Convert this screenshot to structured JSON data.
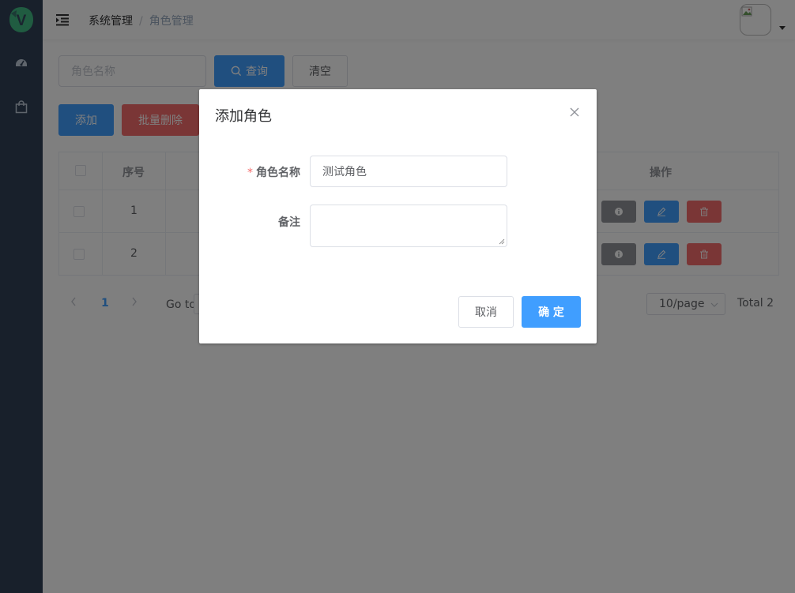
{
  "sidebar": {
    "logo_letter": "V",
    "items": [
      {
        "icon": "dashboard-icon"
      },
      {
        "icon": "shopping-bag-icon"
      }
    ]
  },
  "header": {
    "breadcrumb": [
      "系统管理",
      "角色管理"
    ],
    "separator": "/"
  },
  "search": {
    "placeholder": "角色名称",
    "query_label": "查询",
    "clear_label": "清空"
  },
  "toolbar": {
    "add_label": "添加",
    "batch_delete_label": "批量删除"
  },
  "table": {
    "columns": {
      "index": "序号",
      "actions": "操作"
    },
    "rows": [
      {
        "index": "1"
      },
      {
        "index": "2"
      }
    ]
  },
  "pagination": {
    "current_page": "1",
    "goto_label": "Go to",
    "page_size": "10/page",
    "total": "Total 2"
  },
  "dialog": {
    "title": "添加角色",
    "fields": {
      "name_label": "角色名称",
      "name_value": "测试角色",
      "remark_label": "备注",
      "remark_value": ""
    },
    "cancel_label": "取消",
    "confirm_label": "确 定"
  },
  "colors": {
    "primary": "#409eff",
    "danger": "#f56c6c",
    "info": "#909399",
    "sidebar": "#304156"
  }
}
